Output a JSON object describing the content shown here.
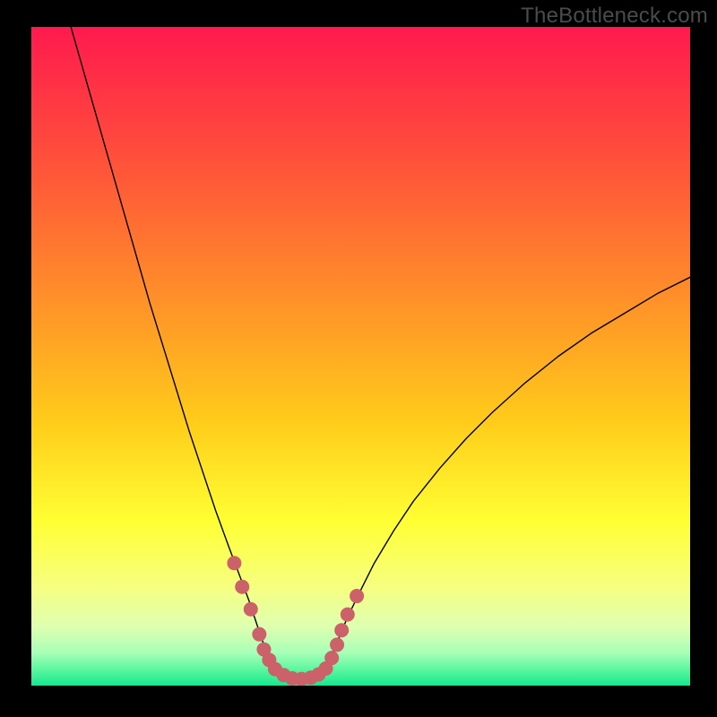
{
  "watermark": "TheBottleneck.com",
  "chart_data": {
    "type": "line",
    "title": "",
    "xlabel": "",
    "ylabel": "",
    "xlim": [
      0,
      100
    ],
    "ylim": [
      0,
      100
    ],
    "background_gradient": {
      "stops": [
        {
          "offset": 0.0,
          "color": "#ff1a4e"
        },
        {
          "offset": 0.18,
          "color": "#ff4a3c"
        },
        {
          "offset": 0.4,
          "color": "#ff8c2a"
        },
        {
          "offset": 0.6,
          "color": "#ffcc1a"
        },
        {
          "offset": 0.75,
          "color": "#ffff33"
        },
        {
          "offset": 0.85,
          "color": "#f6ff80"
        },
        {
          "offset": 0.91,
          "color": "#dfffb0"
        },
        {
          "offset": 0.95,
          "color": "#a8ffb8"
        },
        {
          "offset": 0.975,
          "color": "#5cf7a0"
        },
        {
          "offset": 1.0,
          "color": "#17e88e"
        }
      ]
    },
    "series": [
      {
        "name": "curve",
        "stroke": "#000000",
        "stroke_width": 1.4,
        "points": [
          {
            "x": 6.0,
            "y": 100.0
          },
          {
            "x": 8.0,
            "y": 93.0
          },
          {
            "x": 10.0,
            "y": 86.0
          },
          {
            "x": 12.0,
            "y": 79.0
          },
          {
            "x": 14.0,
            "y": 72.0
          },
          {
            "x": 16.0,
            "y": 65.0
          },
          {
            "x": 18.0,
            "y": 58.0
          },
          {
            "x": 20.0,
            "y": 51.5
          },
          {
            "x": 22.0,
            "y": 45.0
          },
          {
            "x": 24.0,
            "y": 38.5
          },
          {
            "x": 26.0,
            "y": 32.5
          },
          {
            "x": 28.0,
            "y": 26.5
          },
          {
            "x": 30.0,
            "y": 21.0
          },
          {
            "x": 31.5,
            "y": 17.0
          },
          {
            "x": 33.0,
            "y": 13.0
          },
          {
            "x": 34.0,
            "y": 10.0
          },
          {
            "x": 35.0,
            "y": 7.0
          },
          {
            "x": 36.0,
            "y": 4.5
          },
          {
            "x": 37.0,
            "y": 2.8
          },
          {
            "x": 38.0,
            "y": 1.7
          },
          {
            "x": 39.0,
            "y": 1.1
          },
          {
            "x": 40.0,
            "y": 0.8
          },
          {
            "x": 41.0,
            "y": 0.8
          },
          {
            "x": 42.0,
            "y": 0.9
          },
          {
            "x": 43.0,
            "y": 1.3
          },
          {
            "x": 44.0,
            "y": 2.2
          },
          {
            "x": 45.0,
            "y": 3.6
          },
          {
            "x": 46.0,
            "y": 5.6
          },
          {
            "x": 47.0,
            "y": 8.0
          },
          {
            "x": 48.0,
            "y": 10.4
          },
          {
            "x": 50.0,
            "y": 14.5
          },
          {
            "x": 52.0,
            "y": 18.5
          },
          {
            "x": 55.0,
            "y": 23.5
          },
          {
            "x": 58.0,
            "y": 28.0
          },
          {
            "x": 62.0,
            "y": 33.0
          },
          {
            "x": 66.0,
            "y": 37.5
          },
          {
            "x": 70.0,
            "y": 41.5
          },
          {
            "x": 75.0,
            "y": 46.0
          },
          {
            "x": 80.0,
            "y": 50.0
          },
          {
            "x": 85.0,
            "y": 53.5
          },
          {
            "x": 90.0,
            "y": 56.5
          },
          {
            "x": 95.0,
            "y": 59.5
          },
          {
            "x": 100.0,
            "y": 62.0
          }
        ]
      }
    ],
    "markers": {
      "fill": "#cb6169",
      "radius": 8,
      "points": [
        {
          "x": 30.8,
          "y": 18.6
        },
        {
          "x": 32.0,
          "y": 15.0
        },
        {
          "x": 33.3,
          "y": 11.6
        },
        {
          "x": 34.6,
          "y": 7.8
        },
        {
          "x": 35.3,
          "y": 5.5
        },
        {
          "x": 36.1,
          "y": 3.9
        },
        {
          "x": 37.0,
          "y": 2.5
        },
        {
          "x": 38.3,
          "y": 1.6
        },
        {
          "x": 39.6,
          "y": 1.1
        },
        {
          "x": 41.0,
          "y": 1.0
        },
        {
          "x": 42.4,
          "y": 1.2
        },
        {
          "x": 43.6,
          "y": 1.7
        },
        {
          "x": 44.7,
          "y": 2.6
        },
        {
          "x": 45.6,
          "y": 4.2
        },
        {
          "x": 46.4,
          "y": 6.2
        },
        {
          "x": 47.1,
          "y": 8.4
        },
        {
          "x": 48.0,
          "y": 10.8
        },
        {
          "x": 49.4,
          "y": 13.6
        }
      ]
    }
  }
}
